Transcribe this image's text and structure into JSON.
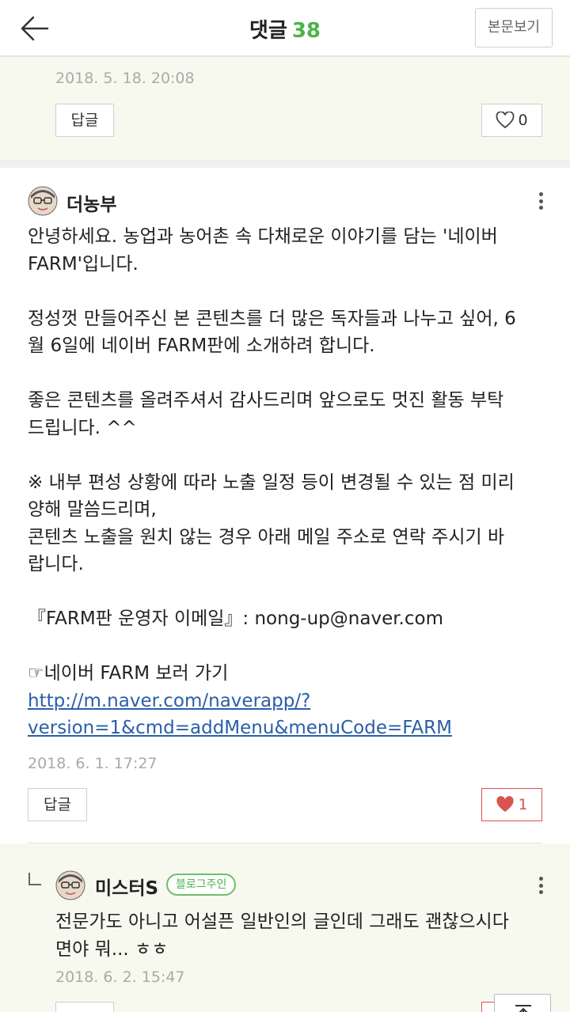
{
  "header": {
    "title": "댓글",
    "count": "38",
    "view_post_label": "본문보기"
  },
  "prev_comment": {
    "date": "2018. 5. 18. 20:08",
    "reply_label": "답글",
    "like_count": "0"
  },
  "main_comment": {
    "author": "더농부",
    "paragraphs": [
      [
        "안녕하세요. 농업과 농어촌 속 다채로운 이야기를 담는 '네이버",
        "FARM'입니다."
      ],
      [
        "정성껏 만들어주신 본 콘텐츠를 더 많은 독자들과 나누고 싶어, 6",
        "월 6일에 네이버 FARM판에 소개하려 합니다."
      ],
      [
        "좋은 콘텐츠를 올려주셔서 감사드리며 앞으로도 멋진 활동 부탁",
        "드립니다. ^^"
      ],
      [
        "※ 내부 편성 상황에 따라 노출 일정 등이 변경될 수 있는 점 미리",
        "양해 말씀드리며,",
        "콘텐츠 노출을 원치 않는 경우 아래 메일 주소로 연락 주시기 바",
        "랍니다."
      ],
      [
        "『FARM판 운영자 이메일』: nong-up@naver.com"
      ],
      [
        "☞네이버 FARM 보러 가기"
      ]
    ],
    "link_line1": "http://m.naver.com/naverapp/?",
    "link_line2": "version=1&cmd=addMenu&menuCode=FARM",
    "date": "2018. 6. 1. 17:27",
    "reply_label": "답글",
    "like_count": "1"
  },
  "reply_comment": {
    "author": "미스터S",
    "badge": "블로그주인",
    "text_line1": "전문가도 아니고 어설픈 일반인의 글인데 그래도 괜찮으시다",
    "text_line2": "면야 뭐... ㅎㅎ",
    "date": "2018. 6. 2. 15:47"
  },
  "colors": {
    "accent": "#4cb34a",
    "liked": "#d9534f",
    "highlight_bg": "#f7f9ef",
    "link": "#2b5ea8"
  }
}
